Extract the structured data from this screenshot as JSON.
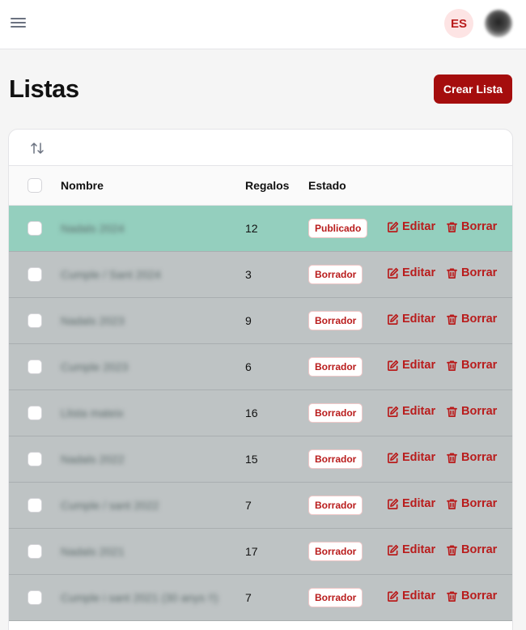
{
  "header": {
    "language_badge": "ES"
  },
  "page": {
    "title": "Listas",
    "create_button": "Crear Lista"
  },
  "table": {
    "columns": {
      "name": "Nombre",
      "gifts": "Regalos",
      "status": "Estado"
    },
    "actions": {
      "edit": "Editar",
      "delete": "Borrar"
    },
    "rows": [
      {
        "name": "Nadals 2024",
        "gifts": "12",
        "status": "Publicado"
      },
      {
        "name": "Cumple / Sant 2024",
        "gifts": "3",
        "status": "Borrador"
      },
      {
        "name": "Nadals 2023",
        "gifts": "9",
        "status": "Borrador"
      },
      {
        "name": "Cumple 2023",
        "gifts": "6",
        "status": "Borrador"
      },
      {
        "name": "Llista mateix",
        "gifts": "16",
        "status": "Borrador"
      },
      {
        "name": "Nadals 2022",
        "gifts": "15",
        "status": "Borrador"
      },
      {
        "name": "Cumple / sant 2022",
        "gifts": "7",
        "status": "Borrador"
      },
      {
        "name": "Nadals 2021",
        "gifts": "17",
        "status": "Borrador"
      },
      {
        "name": "Cumple i sant 2021 (30 anys !!)",
        "gifts": "7",
        "status": "Borrador"
      }
    ]
  },
  "colors": {
    "accent": "#a50d0d",
    "published_row": "#94cfbe",
    "draft_row": "#bec3c4"
  }
}
